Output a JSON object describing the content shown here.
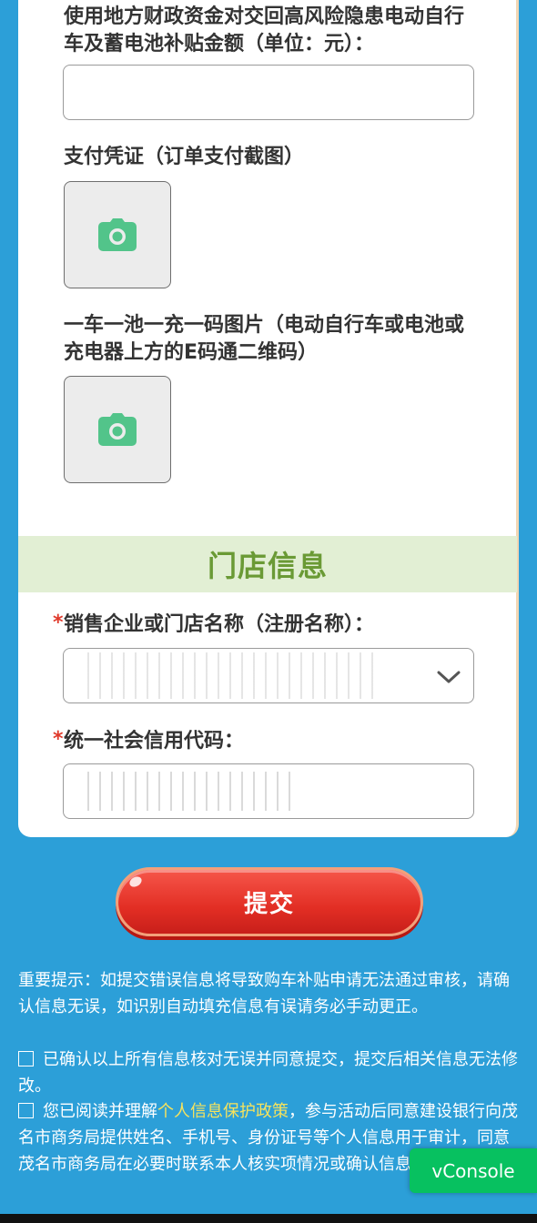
{
  "form": {
    "subsidy_amount_label": "使用地方财政资金对交回高风险隐患电动自行车及蓄电池补贴金额（单位：元）：",
    "subsidy_amount_value": "",
    "payment_proof_label": "支付凭证（订单支付截图）",
    "ecode_label": "一车一池一充一码图片（电动自行车或电池或充电器上方的E码通二维码）"
  },
  "store_section": {
    "title": "门店信息",
    "required_mark": "*",
    "store_name_label": "销售企业或门店名称（注册名称）：",
    "credit_code_label": "统一社会信用代码："
  },
  "submit_label": "提交",
  "notices": {
    "important": "重要提示：如提交错误信息将导致购车补贴申请无法通过审核，请确认信息无误，如识别自动填充信息有误请务必手动更正。",
    "confirm": "已确认以上所有信息核对无误并同意提交，提交后相关信息无法修改。",
    "privacy_prefix": "您已阅读并理解",
    "privacy_link": "个人信息保护政策",
    "privacy_suffix": "，参与活动后同意建设银行向茂名市商务局提供姓名、手机号、身份证号等个人信息用于审计，同意茂名市商务局在必要时联系本人核实项情况或确认信息。"
  },
  "vconsole_label": "vConsole",
  "colors": {
    "background": "#2c9fd8",
    "section_bar": "#e2efd4",
    "section_title": "#6a9a35",
    "required": "#e03a2c",
    "camera_icon": "#52c48a",
    "submit": "#e22e24",
    "link": "#f7e35c",
    "vconsole": "#07c160"
  },
  "icons": {
    "upload": "camera-icon",
    "dropdown": "chevron-down-icon"
  }
}
